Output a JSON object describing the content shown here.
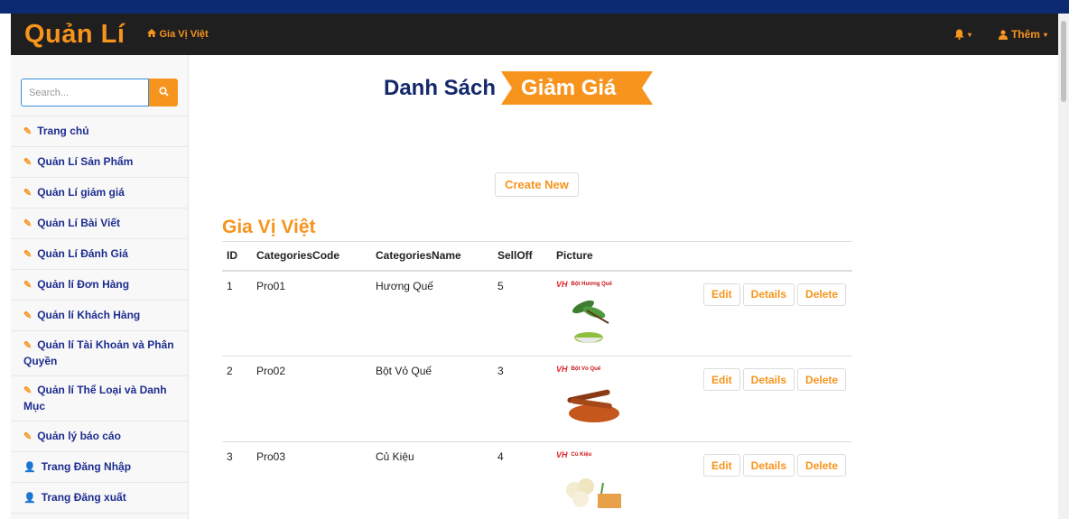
{
  "navbar": {
    "brand": "Quản Lí",
    "home_link": "Gia Vị Việt",
    "notif_caret": "▾",
    "more_label": "Thêm"
  },
  "sidebar": {
    "search_placeholder": "Search...",
    "items": [
      {
        "label": "Trang chủ",
        "icon": "edit-icon"
      },
      {
        "label": "Quản Lí Sản Phẩm",
        "icon": "edit-icon"
      },
      {
        "label": "Quản Lí giảm giá",
        "icon": "edit-icon"
      },
      {
        "label": "Quản Lí Bài Viết",
        "icon": "edit-icon"
      },
      {
        "label": "Quản Lí Đánh Giá",
        "icon": "edit-icon"
      },
      {
        "label": "Quản lí Đơn Hàng",
        "icon": "edit-icon"
      },
      {
        "label": "Quản lí Khách Hàng",
        "icon": "edit-icon"
      },
      {
        "label": "Quản lí Tài Khoản và Phân Quyền",
        "icon": "edit-icon"
      },
      {
        "label": "Quản lí Thể Loại và Danh Mục",
        "icon": "edit-icon"
      },
      {
        "label": "Quản lý báo cáo",
        "icon": "edit-icon"
      },
      {
        "label": "Trang Đăng Nhập",
        "icon": "user-icon"
      },
      {
        "label": "Trang Đăng xuất",
        "icon": "user-icon"
      }
    ]
  },
  "main": {
    "title_part1": "Danh Sách",
    "title_part2": "Giảm Giá",
    "create_label": "Create New",
    "heading": "Gia Vị Việt",
    "columns": [
      "ID",
      "CategoriesCode",
      "CategoriesName",
      "SellOff",
      "Picture"
    ],
    "rows": [
      {
        "id": "1",
        "code": "Pro01",
        "name": "Hương Quế",
        "selloff": "5",
        "logo_text": "Bột Hương Quế"
      },
      {
        "id": "2",
        "code": "Pro02",
        "name": "Bột Vỏ Quế",
        "selloff": "3",
        "logo_text": "Bột Vỏ Quế"
      },
      {
        "id": "3",
        "code": "Pro03",
        "name": "Củ Kiệu",
        "selloff": "4",
        "logo_text": "Củ Kiệu"
      }
    ],
    "actions": {
      "edit": "Edit",
      "details": "Details",
      "delete": "Delete"
    }
  },
  "colors": {
    "accent": "#f7941d",
    "navy": "#13286b",
    "navbar": "#1f1f1f"
  }
}
